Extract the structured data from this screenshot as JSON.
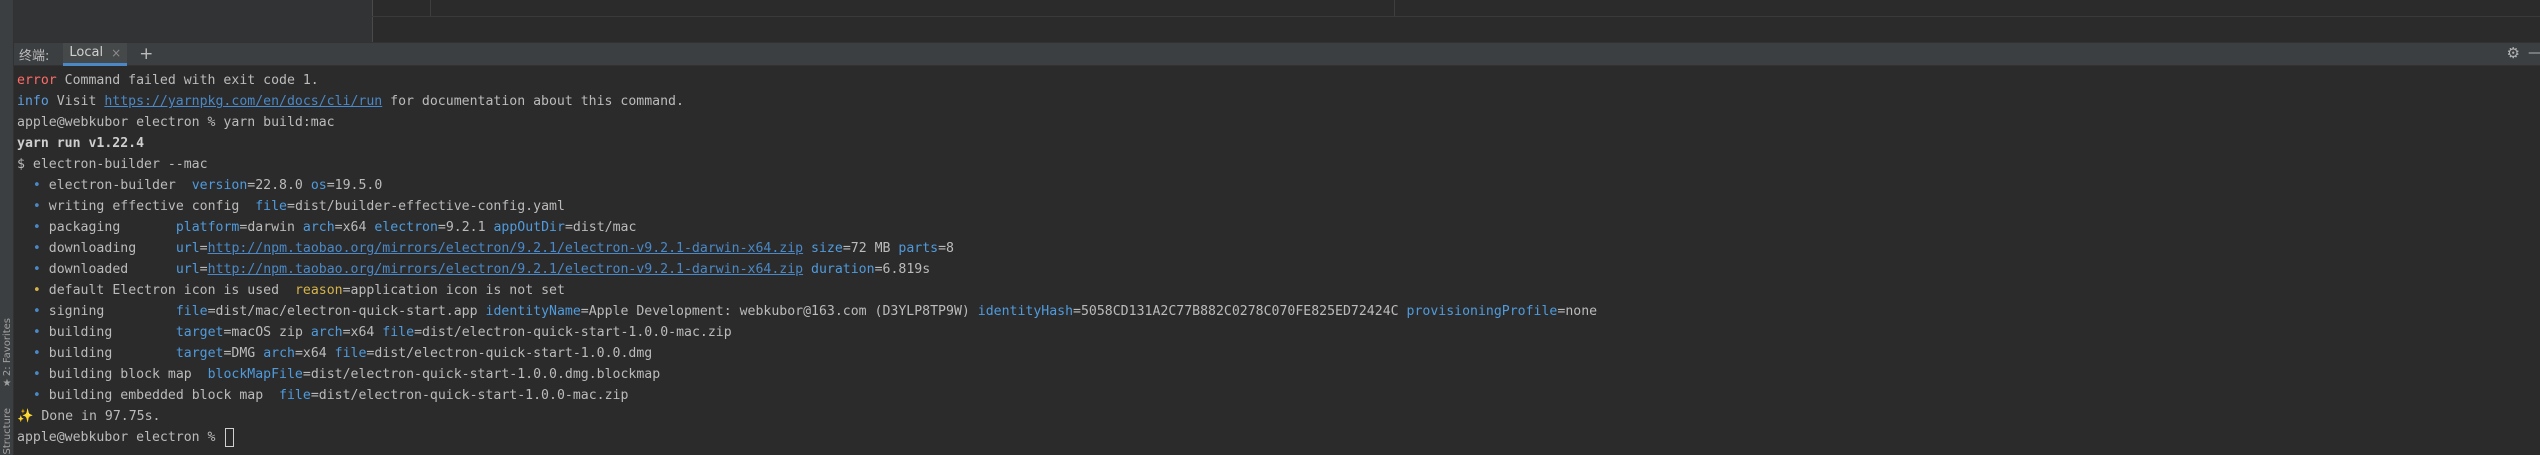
{
  "left_strip": {
    "favorites_label": "2: Favorites",
    "structure_label": "Structure"
  },
  "terminal": {
    "title": "终端:",
    "tab_label": "Local",
    "close_glyph": "×",
    "new_tab_glyph": "+",
    "gear_glyph": "⚙",
    "minimize_glyph": "—"
  },
  "output": {
    "l1": {
      "kw": "error",
      "text": " Command failed with exit code 1."
    },
    "l2": {
      "kw": "info",
      "pre": " Visit ",
      "link": "https://yarnpkg.com/en/docs/cli/run",
      "post": " for documentation about this command."
    },
    "l3": "apple@webkubor electron % yarn build:mac",
    "l4": "yarn run v1.22.4",
    "l5": "$ electron-builder --mac",
    "bullet": "•",
    "l6": {
      "label": "electron-builder  ",
      "k1": "version",
      "v1": "=22.8.0 ",
      "k2": "os",
      "v2": "=19.5.0"
    },
    "l7": {
      "label": "writing effective config  ",
      "k1": "file",
      "v1": "=dist/builder-effective-config.yaml"
    },
    "l8": {
      "label": "packaging       ",
      "k1": "platform",
      "v1": "=darwin ",
      "k2": "arch",
      "v2": "=x64 ",
      "k3": "electron",
      "v3": "=9.2.1 ",
      "k4": "appOutDir",
      "v4": "=dist/mac"
    },
    "l9": {
      "label": "downloading     ",
      "k1": "url",
      "v1": "=",
      "link": "http://npm.taobao.org/mirrors/electron/9.2.1/electron-v9.2.1-darwin-x64.zip",
      "k2": "size",
      "v2": "=72 MB ",
      "k3": "parts",
      "v3": "=8"
    },
    "l10": {
      "label": "downloaded      ",
      "k1": "url",
      "v1": "=",
      "link": "http://npm.taobao.org/mirrors/electron/9.2.1/electron-v9.2.1-darwin-x64.zip",
      "k2": "duration",
      "v2": "=6.819s"
    },
    "l11": {
      "label": "default Electron icon is used  ",
      "k1": "reason",
      "v1": "=application icon is not set"
    },
    "l12": {
      "label": "signing         ",
      "k1": "file",
      "v1": "=dist/mac/electron-quick-start.app ",
      "k2": "identityName",
      "v2": "=Apple Development: webkubor@163.com (D3YLP8TP9W) ",
      "k3": "identityHash",
      "v3": "=5058CD131A2C77B882C0278C070FE825ED72424C ",
      "k4": "provisioningProfile",
      "v4": "=none"
    },
    "l13": {
      "label": "building        ",
      "k1": "target",
      "v1": "=macOS zip ",
      "k2": "arch",
      "v2": "=x64 ",
      "k3": "file",
      "v3": "=dist/electron-quick-start-1.0.0-mac.zip"
    },
    "l14": {
      "label": "building        ",
      "k1": "target",
      "v1": "=DMG ",
      "k2": "arch",
      "v2": "=x64 ",
      "k3": "file",
      "v3": "=dist/electron-quick-start-1.0.0.dmg"
    },
    "l15": {
      "label": "building block map  ",
      "k1": "blockMapFile",
      "v1": "=dist/electron-quick-start-1.0.0.dmg.blockmap"
    },
    "l16": {
      "label": "building embedded block map  ",
      "k1": "file",
      "v1": "=dist/electron-quick-start-1.0.0-mac.zip"
    },
    "l17": {
      "sparkle": "✨",
      "text": " Done in 97.75s."
    },
    "l18": "apple@webkubor electron % "
  }
}
